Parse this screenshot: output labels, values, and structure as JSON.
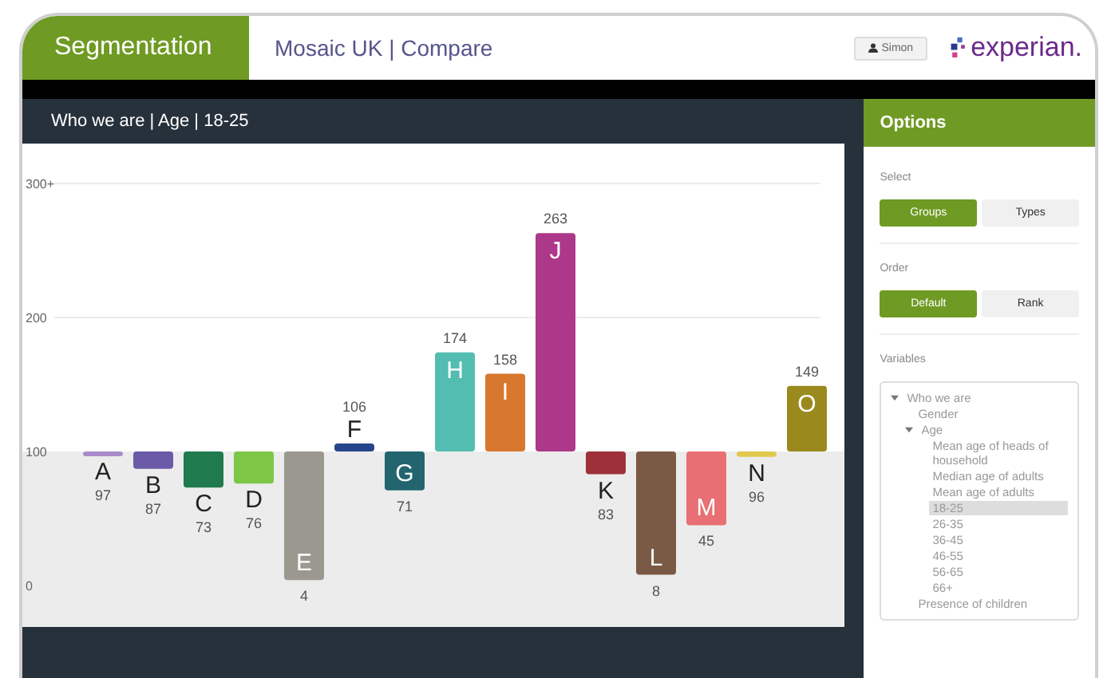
{
  "header": {
    "section": "Segmentation",
    "title": "Mosaic UK | Compare",
    "user": "Simon",
    "logo": "experian."
  },
  "chart_panel": {
    "title": "Who we are | Age | 18-25",
    "y_ticks": [
      "300+",
      "200",
      "100",
      "0"
    ],
    "bars": [
      {
        "letter": "A",
        "value": "97",
        "color": "#a98bc9"
      },
      {
        "letter": "B",
        "value": "87",
        "color": "#6a5aa8"
      },
      {
        "letter": "C",
        "value": "73",
        "color": "#1f7a4e"
      },
      {
        "letter": "D",
        "value": "76",
        "color": "#7dc646"
      },
      {
        "letter": "E",
        "value": "4",
        "color": "#9b9890"
      },
      {
        "letter": "F",
        "value": "106",
        "color": "#27458a"
      },
      {
        "letter": "G",
        "value": "71",
        "color": "#22656e"
      },
      {
        "letter": "H",
        "value": "174",
        "color": "#52bdb0"
      },
      {
        "letter": "I",
        "value": "158",
        "color": "#d8782e"
      },
      {
        "letter": "J",
        "value": "263",
        "color": "#ad3889"
      },
      {
        "letter": "K",
        "value": "83",
        "color": "#9d3039"
      },
      {
        "letter": "L",
        "value": "8",
        "color": "#7a5a44"
      },
      {
        "letter": "M",
        "value": "45",
        "color": "#e86f73"
      },
      {
        "letter": "N",
        "value": "96",
        "color": "#e0c94e"
      },
      {
        "letter": "O",
        "value": "149",
        "color": "#9a8a1e"
      }
    ]
  },
  "options": {
    "title": "Options",
    "select": {
      "label": "Select",
      "buttons": [
        {
          "label": "Groups",
          "selected": true
        },
        {
          "label": "Types",
          "selected": false
        }
      ]
    },
    "order": {
      "label": "Order",
      "buttons": [
        {
          "label": "Default",
          "selected": true
        },
        {
          "label": "Rank",
          "selected": false
        }
      ]
    },
    "variables": {
      "label": "Variables",
      "tree": [
        {
          "label": "Who we are",
          "expanded": true,
          "selected": false,
          "children": [
            {
              "label": "Gender",
              "selected": false
            },
            {
              "label": "Age",
              "expanded": true,
              "selected": false,
              "children": [
                {
                  "label": "Mean age of heads of household",
                  "selected": false
                },
                {
                  "label": "Median age of adults",
                  "selected": false
                },
                {
                  "label": "Mean age of adults",
                  "selected": false
                },
                {
                  "label": "18-25",
                  "selected": true
                },
                {
                  "label": "26-35",
                  "selected": false
                },
                {
                  "label": "36-45",
                  "selected": false
                },
                {
                  "label": "46-55",
                  "selected": false
                },
                {
                  "label": "56-65",
                  "selected": false
                },
                {
                  "label": "66+",
                  "selected": false
                }
              ]
            },
            {
              "label": "Presence of children",
              "selected": false
            }
          ]
        }
      ]
    }
  }
}
